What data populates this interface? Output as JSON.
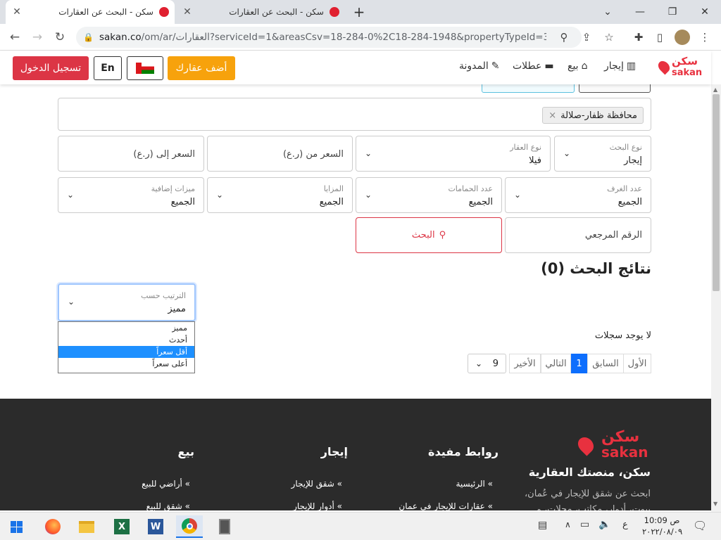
{
  "browser": {
    "tabs": [
      {
        "title": "سكن - البحث عن العقارات",
        "active": true
      },
      {
        "title": "سكن - البحث عن العقارات",
        "active": false
      }
    ],
    "new_tab": "+",
    "url_host": "sakan.co",
    "url_path": "/om/ar/العقارات?serviceId=1&areasCsv=18-284-0%2C18-284-1948&propertyTypeId=30&am..."
  },
  "header": {
    "logo_ar": "سكن",
    "logo_en": "sakan",
    "nav": [
      {
        "label": "إيجار",
        "icon": "building-icon"
      },
      {
        "label": "بيع",
        "icon": "home-icon"
      },
      {
        "label": "عطلات",
        "icon": "bed-icon"
      },
      {
        "label": "المدونة",
        "icon": "blog-icon"
      }
    ],
    "add_property": "أضف عقارك",
    "lang": "En",
    "login": "تسجيل الدخول"
  },
  "search": {
    "location_tag": "محافظة ظفار-صلالة",
    "search_type": {
      "label": "نوع البحث",
      "value": "إيجار"
    },
    "property_type": {
      "label": "نوع العقار",
      "value": "فيلا"
    },
    "price_from": "السعر من (ر.ع)",
    "price_to": "السعر إلى (ر.ع)",
    "rooms": {
      "label": "عدد الغرف",
      "value": "الجميع"
    },
    "baths": {
      "label": "عدد الحمامات",
      "value": "الجميع"
    },
    "features": {
      "label": "المزايا",
      "value": "الجميع"
    },
    "extras": {
      "label": "ميزات إضافية",
      "value": "الجميع"
    },
    "reference": "الرقم المرجعي",
    "search_btn": "البحث"
  },
  "results": {
    "title": "نتائج البحث (0)",
    "sort": {
      "label": "الترتيب حسب",
      "value": "مميز"
    },
    "sort_options": [
      "مميز",
      "أحدث",
      "أقل سعراً",
      "أعلى سعراً"
    ],
    "sort_highlighted": 2,
    "no_records": "لا يوجد سجلات",
    "pagination": {
      "first": "الأول",
      "prev": "السابق",
      "current": "1",
      "next": "التالي",
      "last": "الأخير"
    },
    "page_size": "9"
  },
  "footer": {
    "logo_ar": "سكن",
    "logo_en": "sakan",
    "tagline": "سكن، منصتك العقارية",
    "desc1": "ابحث عن شقق للإيجار في عُمان،",
    "desc2": "بيوت، أدوار، مكاتب، محلات، و",
    "col1_title": "روابط مفيدة",
    "col1_items": [
      "» الرئيسية",
      "» عقارات للإيجار في عمان"
    ],
    "col2_title": "إيجار",
    "col2_items": [
      "» شقق للإيجار",
      "» أدوار للإيجار"
    ],
    "col3_title": "بيع",
    "col3_items": [
      "» أراضي للبيع",
      "» شقق للبيع"
    ]
  },
  "taskbar": {
    "lang": "ع",
    "ampm": "ص",
    "time": "10:09",
    "date": "٢٠٢٢/٠٨/٠٩"
  },
  "colors": {
    "brand_red": "#e8313f",
    "login_red": "#dc3545",
    "add_orange": "#f7a20c",
    "highlight_blue": "#1e90ff",
    "footer_bg": "#2b2b2b"
  }
}
